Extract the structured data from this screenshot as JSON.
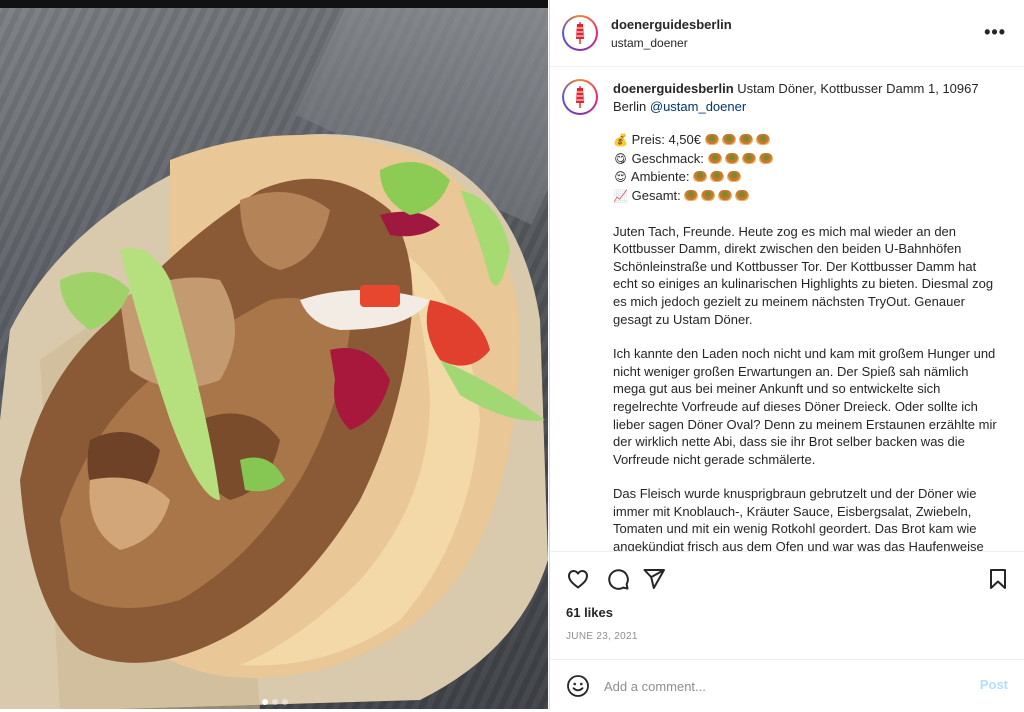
{
  "post": {
    "username": "doenerguidesberlin",
    "location": "ustam_doener",
    "more_label": "•••",
    "brand_color": "#e0242b"
  },
  "caption": {
    "username": "doenerguidesberlin",
    "intro": "Ustam Döner, Kottbusser Damm 1, 10967 Berlin",
    "mention": "@ustam_doener",
    "ratings": [
      {
        "icon": "money-bag",
        "emoji": "💰",
        "label": "Preis: 4,50€",
        "score": 4
      },
      {
        "icon": "smiling-face",
        "emoji": "😋",
        "label": "Geschmack:",
        "score": 4
      },
      {
        "icon": "relieved-face",
        "emoji": "😌",
        "label": "Ambiente:",
        "score": 3
      },
      {
        "icon": "chart-up",
        "emoji": "📈",
        "label": "Gesamt:",
        "score": 4
      }
    ],
    "paragraphs": [
      "Juten Tach, Freunde. Heute zog es mich mal wieder an den Kottbusser Damm, direkt zwischen den beiden U-Bahnhöfen Schönleinstraße und Kottbusser Tor. Der Kottbusser Damm hat echt so einiges an kulinarischen Highlights zu bieten. Diesmal zog es mich jedoch gezielt zu meinem nächsten TryOut. Genauer gesagt zu Ustam Döner.",
      "Ich kannte den Laden noch nicht und kam mit großem Hunger und nicht weniger großen Erwartungen an. Der Spieß sah nämlich mega gut aus bei meiner Ankunft und so entwickelte sich regelrechte Vorfreude auf dieses Döner Dreieck. Oder sollte ich lieber sagen Döner Oval? Denn zu meinem Erstaunen erzählte mir der wirklich nette Abi, dass sie ihr Brot selber backen was die Vorfreude nicht gerade schmälerte.",
      "Das Fleisch wurde knusprigbraun gebrutzelt und der Döner wie immer mit Knoblauch-, Kräuter Sauce, Eisbergsalat, Zwiebeln, Tomaten und mit ein wenig Rotkohl geordert. Das Brot kam wie angekündigt frisch aus dem Ofen und war was das Haufenweise Leckeres ein Highlight an diesem Tag."
    ]
  },
  "actions": {
    "likes": "61 likes",
    "date": "JUNE 23, 2021"
  },
  "comment": {
    "placeholder": "Add a comment...",
    "post_label": "Post"
  }
}
